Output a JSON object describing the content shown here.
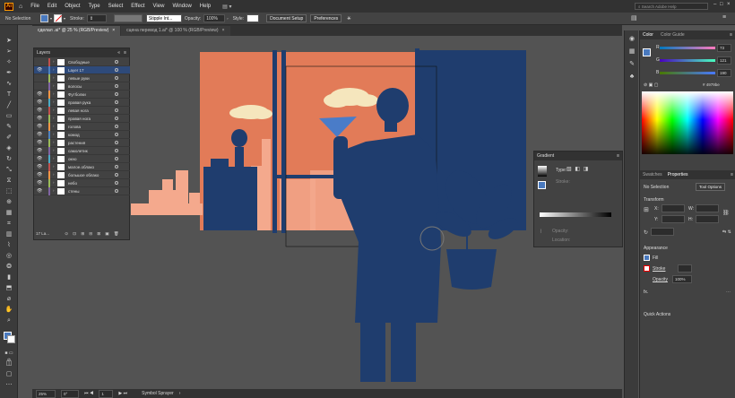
{
  "menu": {
    "app_badge": "Ai",
    "items": [
      "File",
      "Edit",
      "Object",
      "Type",
      "Select",
      "Effect",
      "View",
      "Window",
      "Help"
    ],
    "search_placeholder": "Search Adobe Help"
  },
  "control": {
    "selection": "No Selection",
    "stroke_label": "Stroke:",
    "brush": "Stipple Int...",
    "opacity_label": "Opacity:",
    "opacity_value": "100%",
    "style_label": "Style:",
    "doc_setup": "Document Setup",
    "preferences": "Preferences"
  },
  "tabs": [
    {
      "label": "сделал .ai* @ 25 % (RGB/Preview)",
      "close": "×"
    },
    {
      "label": "сцена перевод 1.ai* @ 100 % (RGB/Preview)",
      "close": "×"
    }
  ],
  "layers": {
    "title": "Layers",
    "rows": [
      {
        "name": "Свободные",
        "color": "#c0504d",
        "eye": false
      },
      {
        "name": "Layer 17",
        "color": "#4f81bd",
        "eye": true
      },
      {
        "name": "левые руки",
        "color": "#9bbb59",
        "eye": false
      },
      {
        "name": "волосы",
        "color": "#8064a2",
        "eye": false
      },
      {
        "name": "Футболки",
        "color": "#f79646",
        "eye": true
      },
      {
        "name": "правая рука",
        "color": "#4bacc6",
        "eye": true
      },
      {
        "name": "левая нога",
        "color": "#c0504d",
        "eye": true
      },
      {
        "name": "правая нога",
        "color": "#9bbb59",
        "eye": true
      },
      {
        "name": "голова",
        "color": "#f79646",
        "eye": true
      },
      {
        "name": "комод",
        "color": "#4f81bd",
        "eye": true
      },
      {
        "name": "растения",
        "color": "#9bbb59",
        "eye": true
      },
      {
        "name": "самолетик",
        "color": "#8064a2",
        "eye": true
      },
      {
        "name": "окно",
        "color": "#4bacc6",
        "eye": true
      },
      {
        "name": "малое.облако",
        "color": "#c0504d",
        "eye": true
      },
      {
        "name": "большое облако",
        "color": "#f79646",
        "eye": true
      },
      {
        "name": "небо",
        "color": "#9bbb59",
        "eye": true
      },
      {
        "name": "стены",
        "color": "#8064a2",
        "eye": true
      }
    ],
    "footer": "17 La..."
  },
  "color_panel": {
    "tab_color": "Color",
    "tab_guide": "Color Guide",
    "r_label": "R",
    "r_value": "73",
    "g_label": "G",
    "g_value": "121",
    "b_label": "B",
    "b_value": "190",
    "hex": "4979be"
  },
  "gradient_panel": {
    "title": "Gradient",
    "type_label": "Type:",
    "stroke_label": "Stroke:",
    "opacity_label": "Opacity:",
    "location_label": "Location:"
  },
  "props_panel": {
    "tab_swatches": "Swatches",
    "tab_properties": "Properties",
    "selection": "No Selection",
    "tool_options": "Tool Options",
    "transform": "Transform",
    "x_label": "X:",
    "y_label": "Y:",
    "w_label": "W:",
    "h_label": "H:",
    "appearance": "Appearance",
    "fill_label": "Fill",
    "stroke_label": "Stroke",
    "opacity_label": "Opacity",
    "opacity_value": "100%",
    "fx_label": "fx.",
    "quick_actions": "Quick Actions"
  },
  "status": {
    "zoom": "25%",
    "angle": "0°",
    "artboard": "1",
    "tool": "Symbol Sprayer"
  },
  "colors": {
    "navy": "#1f3d6e",
    "orange": "#e27b58",
    "peach": "#f4a98d",
    "cloud": "#f5e6bd",
    "plane": "#4a7cc8"
  }
}
